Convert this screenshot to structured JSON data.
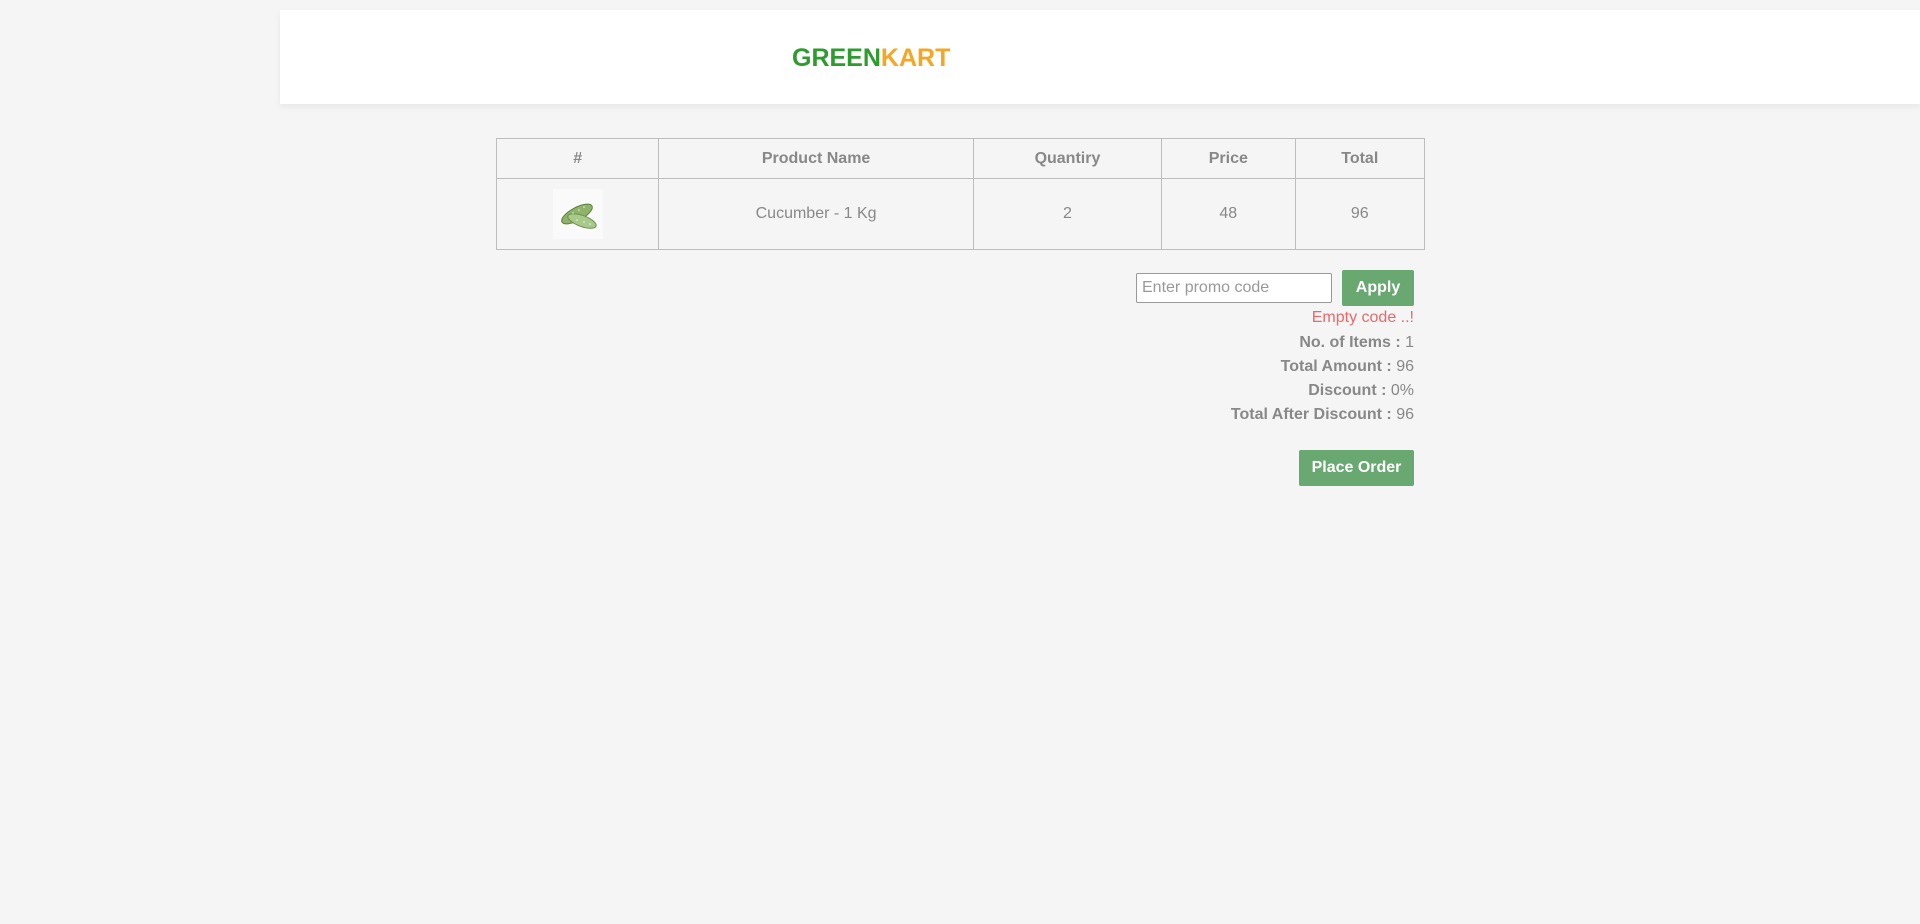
{
  "header": {
    "brand_part1": "GREEN",
    "brand_part2": "KART"
  },
  "cart_table": {
    "headers": [
      "#",
      "Product Name",
      "Quantiry",
      "Price",
      "Total"
    ],
    "rows": [
      {
        "image_icon": "cucumber-icon",
        "name": "Cucumber - 1 Kg",
        "quantity": "2",
        "price": "48",
        "total": "96"
      }
    ]
  },
  "promo": {
    "placeholder": "Enter promo code",
    "value": "",
    "apply_label": "Apply",
    "info_text": "Empty code ..!"
  },
  "summary": {
    "items_label": "No. of Items",
    "items_value": "1",
    "total_amount_label": "Total Amount",
    "total_amount_value": "96",
    "discount_label": "Discount",
    "discount_value": "0%",
    "after_discount_label": "Total After Discount",
    "after_discount_value": "96",
    "separator": " : "
  },
  "place_order_label": "Place Order",
  "colors": {
    "brand_green": "#2e9b2e",
    "brand_orange": "#f5a623",
    "button_green": "#69a870",
    "error_red": "#e8696b",
    "background": "#f5f5f5"
  }
}
